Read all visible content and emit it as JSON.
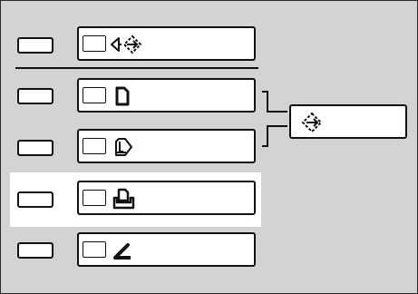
{
  "colors": {
    "panel_background": "#d3d3d3",
    "highlight_background": "#ffffff",
    "line_color": "#111111"
  },
  "highlighted_row": "row-4",
  "rows": [
    {
      "id": "row-1",
      "icon": "auto-detect-arrows-icon"
    },
    {
      "id": "row-2",
      "icon": "document-icon"
    },
    {
      "id": "row-3",
      "icon": "thick-document-icon"
    },
    {
      "id": "row-4",
      "icon": "stack-tray-icon"
    },
    {
      "id": "row-5",
      "icon": "angle-icon"
    }
  ],
  "auto_select_button": {
    "icon": "auto-select-icon"
  }
}
